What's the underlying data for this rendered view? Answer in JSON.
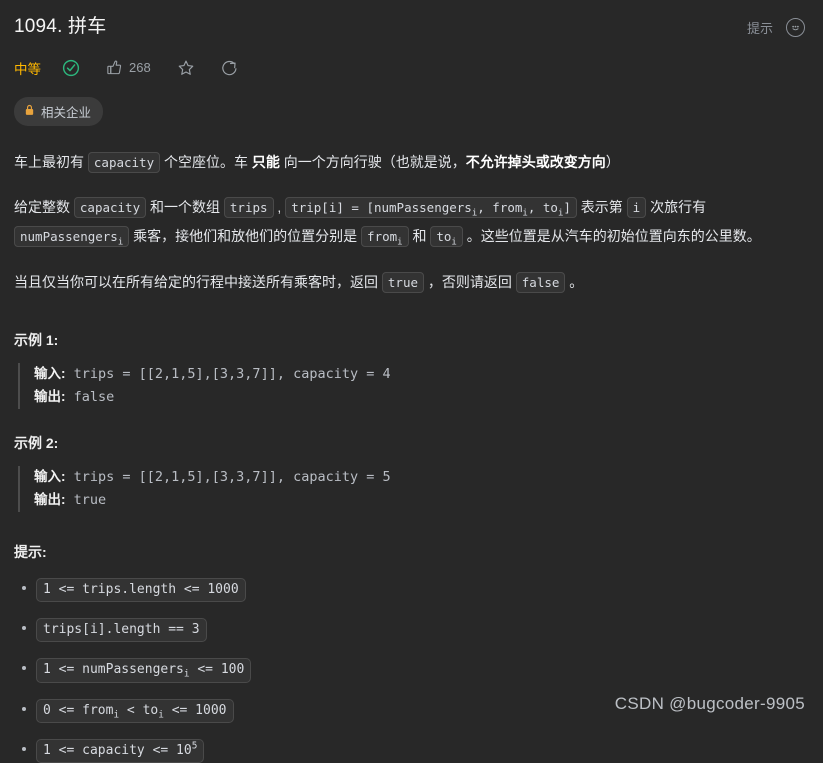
{
  "header": {
    "title": "1094. 拼车",
    "hint_label": "提示",
    "face_icon": "smiley-circle-icon"
  },
  "meta": {
    "difficulty": "中等",
    "solved_icon": "green-check-circle-icon",
    "like_icon": "thumbs-up-icon",
    "like_count": "268",
    "favorite_icon": "star-icon",
    "share_icon": "share-circle-icon"
  },
  "company_tag": {
    "lock_icon": "lock-icon",
    "label": "相关企业"
  },
  "description": {
    "p1": {
      "seg1": "车上最初有 ",
      "code1": "capacity",
      "seg2": " 个空座位。车 ",
      "strong1": "只能",
      "seg3": " 向一个方向行驶（也就是说，",
      "strong2": "不允许掉头或改变方向",
      "seg4": "）"
    },
    "p2": {
      "seg1": "给定整数 ",
      "code1": "capacity",
      "seg2": " 和一个数组 ",
      "code2": "trips",
      "seg3": " , ",
      "code3": "trip[i] = [numPassengersi, fromi, toi]",
      "seg4": " 表示第 ",
      "code4": "i",
      "seg5": " 次旅行有 ",
      "code5": "numPassengersi",
      "seg6": " 乘客，接他们和放他们的位置分别是 ",
      "code6": "fromi",
      "seg7": " 和 ",
      "code7": "toi",
      "seg8": " 。这些位置是从汽车的初始位置向东的公里数。"
    },
    "p3": {
      "seg1": "当且仅当你可以在所有给定的行程中接送所有乘客时，返回 ",
      "code1": "true",
      "seg2": " ，否则请返回 ",
      "code2": "false",
      "seg3": " 。"
    }
  },
  "examples": [
    {
      "title": "示例 1:",
      "input_label": "输入:",
      "input_value": " trips = [[2,1,5],[3,3,7]], capacity = 4",
      "output_label": "输出:",
      "output_value": " false"
    },
    {
      "title": "示例 2:",
      "input_label": "输入:",
      "input_value": " trips = [[2,1,5],[3,3,7]], capacity = 5",
      "output_label": "输出:",
      "output_value": " true"
    }
  ],
  "constraints": {
    "title": "提示:",
    "items": [
      {
        "text": "1 <= trips.length <= 1000"
      },
      {
        "text": "trips[i].length == 3"
      },
      {
        "pre": "1 <= numPassengers",
        "sub": "i",
        "post": " <= 100"
      },
      {
        "pre": "0 <= from",
        "sub": "i",
        "mid": " < to",
        "sub2": "i",
        "post": " <= 1000"
      },
      {
        "pre": "1 <= capacity <= 10",
        "sup": "5"
      }
    ]
  },
  "watermark": "CSDN @bugcoder-9905",
  "colors": {
    "background": "#282828",
    "text": "#e5e7eb",
    "difficulty": "#ffb800",
    "solved": "#2cb67d",
    "code_bg": "#333333",
    "code_border": "#4a4a4a"
  }
}
